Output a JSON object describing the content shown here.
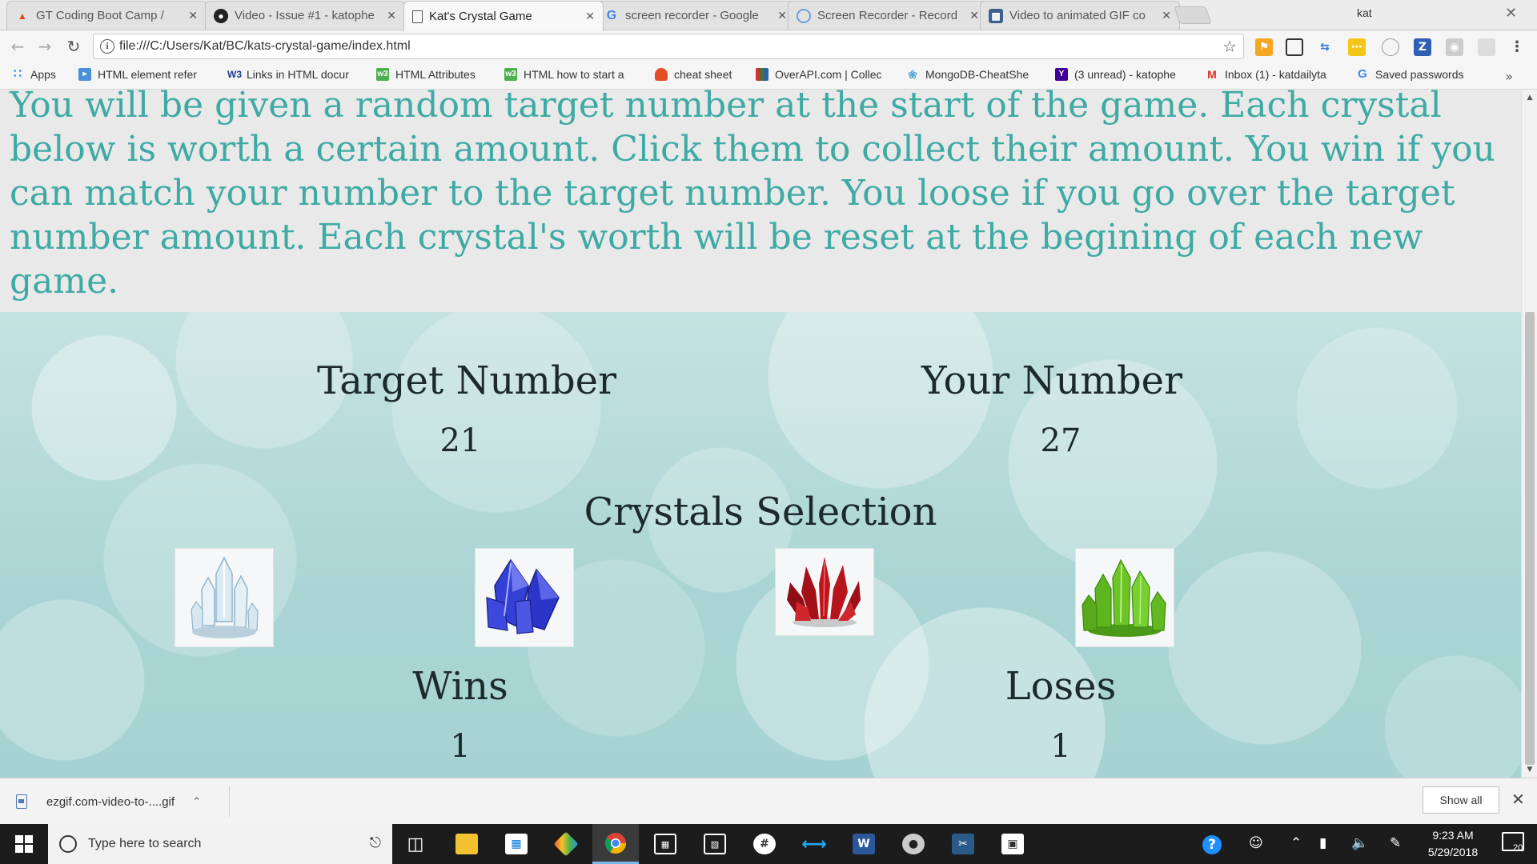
{
  "browser": {
    "tabs": [
      {
        "title": "GT Coding Boot Camp / ",
        "icon": "gitlab-icon"
      },
      {
        "title": "Video - Issue #1 - katophe",
        "icon": "github-icon"
      },
      {
        "title": "Kat's Crystal Game",
        "icon": "page-icon",
        "active": true
      },
      {
        "title": "screen recorder - Google",
        "icon": "google-icon"
      },
      {
        "title": "Screen Recorder - Record",
        "icon": "recorder-icon"
      },
      {
        "title": "Video to animated GIF co",
        "icon": "ezgif-icon"
      }
    ],
    "profile_name": "kat",
    "url": "file:///C:/Users/Kat/BC/kats-crystal-game/index.html",
    "bookmarks": [
      {
        "label": "Apps",
        "icon": "apps-grid-icon",
        "color": "#4285f4"
      },
      {
        "label": "HTML element refer",
        "icon": "mdn-icon",
        "color": "#4a90d9"
      },
      {
        "label": "Links in HTML docur",
        "icon": "w3-icon",
        "color": "#1a3a8a"
      },
      {
        "label": "HTML Attributes",
        "icon": "w3schools-icon",
        "color": "#4caf50"
      },
      {
        "label": "HTML how to start a",
        "icon": "w3schools-icon",
        "color": "#4caf50"
      },
      {
        "label": "cheat sheet",
        "icon": "cheatsheet-icon",
        "color": "#e44d26"
      },
      {
        "label": "OverAPI.com | Collec",
        "icon": "overapi-icon",
        "color": "#3b7a3b"
      },
      {
        "label": "MongoDB-CheatShe",
        "icon": "mongodb-icon",
        "color": "#58a9d6"
      },
      {
        "label": "(3 unread) - katophe",
        "icon": "yahoo-icon",
        "color": "#410093"
      },
      {
        "label": "Inbox (1) - katdailyta",
        "icon": "gmail-icon",
        "color": "#d93025"
      },
      {
        "label": "Saved passwords",
        "icon": "google-icon",
        "color": "#4285f4"
      }
    ]
  },
  "page": {
    "instructions": "You will be given a random target number at the start of the game. Each crystal below is worth a certain amount. Click them to collect their amount. You win if you can match your number to the target number. You loose if you go over the target number amount. Each crystal's worth will be reset at the begining of each new game.",
    "target_label": "Target Number",
    "target_value": "21",
    "your_label": "Your Number",
    "your_value": "27",
    "crystals_label": "Crystals Selection",
    "crystals": [
      {
        "name": "clear-crystal",
        "color": "#cfe3ee"
      },
      {
        "name": "blue-crystal",
        "color": "#2b35c8"
      },
      {
        "name": "red-crystal",
        "color": "#b0141c"
      },
      {
        "name": "green-crystal",
        "color": "#5fb520"
      }
    ],
    "wins_label": "Wins",
    "wins_value": "1",
    "losses_label": "Loses",
    "losses_value": "1"
  },
  "downloads": {
    "file_name": "ezgif.com-video-to-....gif",
    "show_all_label": "Show all"
  },
  "taskbar": {
    "search_placeholder": "Type here to search",
    "time": "9:23 AM",
    "date": "5/29/2018",
    "notification_count": "20"
  }
}
